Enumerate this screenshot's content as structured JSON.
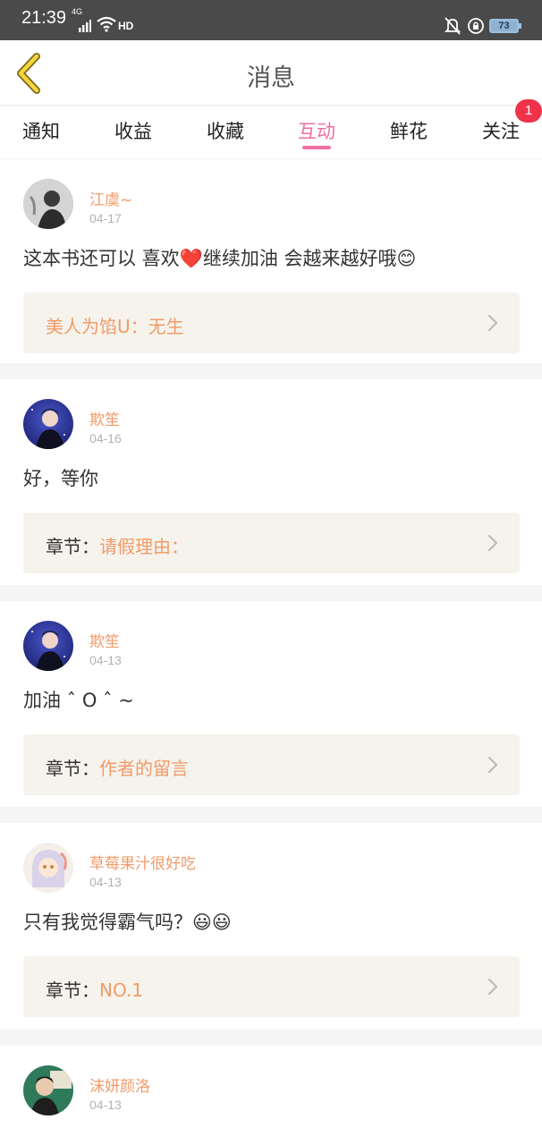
{
  "status_bar": {
    "time": "21:39",
    "network": "4G",
    "hd": "HD",
    "battery": "73"
  },
  "header": {
    "title": "消息"
  },
  "tabs": [
    {
      "label": "通知"
    },
    {
      "label": "收益"
    },
    {
      "label": "收藏"
    },
    {
      "label": "互动"
    },
    {
      "label": "鲜花"
    },
    {
      "label": "关注"
    }
  ],
  "active_tab": "互动",
  "follow_badge": "1",
  "colors": {
    "accent_pink": "#ef6fa4",
    "name_orange": "#f19b6a",
    "badge_red": "#f0334a"
  },
  "messages": [
    {
      "name": "江虞~",
      "date": "04-17",
      "comment": "这本书还可以 喜欢❤️继续加油 会越来越好哦😊",
      "ref_label": "",
      "ref_value": "美人为馅U：无生"
    },
    {
      "name": "欺笙",
      "date": "04-16",
      "comment": "好，等你",
      "ref_label": "章节：",
      "ref_value": "请假理由："
    },
    {
      "name": "欺笙",
      "date": "04-13",
      "comment": "加油 ˆ O ˆ ~",
      "ref_label": "章节：",
      "ref_value": "作者的留言"
    },
    {
      "name": "草莓果汁很好吃",
      "date": "04-13",
      "comment": "只有我觉得霸气吗？😃😃",
      "ref_label": "章节：",
      "ref_value": "NO.1"
    },
    {
      "name": "沫妍颜洛",
      "date": "04-13",
      "comment": ""
    }
  ]
}
